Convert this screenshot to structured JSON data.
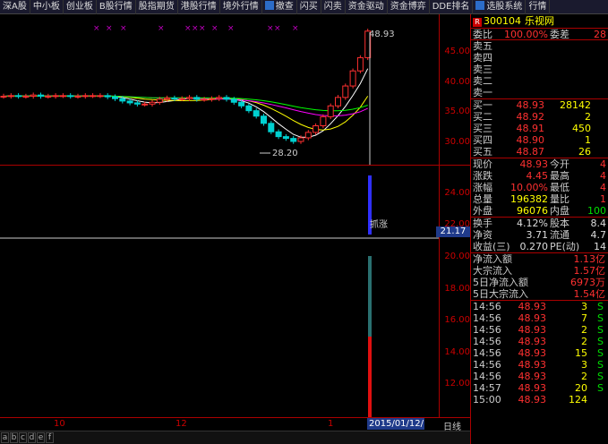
{
  "toolbar": [
    {
      "label": "深A股"
    },
    {
      "label": "中小板"
    },
    {
      "label": "创业板"
    },
    {
      "label": "B股行情"
    },
    {
      "label": "股指期货"
    },
    {
      "label": "港股行情"
    },
    {
      "label": "境外行情"
    },
    {
      "label": "撤查",
      "icon": "search-icon"
    },
    {
      "label": "闪买"
    },
    {
      "label": "闪卖"
    },
    {
      "label": "资金驱动"
    },
    {
      "label": "资金博弈"
    },
    {
      "label": "DDE排名"
    },
    {
      "label": "选股系统",
      "icon": "stock-select-icon"
    },
    {
      "label": "行情"
    }
  ],
  "main_chart": {
    "y_labels": [
      "45.00",
      "40.00",
      "35.00",
      "30.00"
    ],
    "high_label": "48.93",
    "low_label": "28.20"
  },
  "sub_chart": {
    "y_labels": [
      "24.00",
      "22.00",
      "20.00",
      "18.00",
      "16.00",
      "14.00",
      "12.00"
    ],
    "price_tag": "21.17",
    "signal_label": "抓涨"
  },
  "dates": {
    "labels": [
      {
        "text": "10"
      },
      {
        "text": "12"
      },
      {
        "text": "1"
      }
    ],
    "current": "2015/01/12/一",
    "period": "日线"
  },
  "bottom_tabs": [
    "a",
    "b",
    "c",
    "d",
    "e",
    "f"
  ],
  "stock": {
    "badge": "R",
    "code": "300104",
    "name": "乐视网"
  },
  "ratio_row": {
    "label1": "委比",
    "value1": "100.00%",
    "label2": "委差",
    "value2": "28"
  },
  "sell_levels": [
    "卖五",
    "卖四",
    "卖三",
    "卖二",
    "卖一"
  ],
  "buy_levels": [
    {
      "label": "买一",
      "price": "48.93",
      "vol": "28142"
    },
    {
      "label": "买二",
      "price": "48.92",
      "vol": "2"
    },
    {
      "label": "买三",
      "price": "48.91",
      "vol": "450"
    },
    {
      "label": "买四",
      "price": "48.90",
      "vol": "1"
    },
    {
      "label": "买五",
      "price": "48.87",
      "vol": "26"
    }
  ],
  "quote": [
    {
      "l1": "现价",
      "v1": "48.93",
      "l2": "今开",
      "v2": "4"
    },
    {
      "l1": "涨跌",
      "v1": "4.45",
      "l2": "最高",
      "v2": "4"
    },
    {
      "l1": "涨幅",
      "v1": "10.00%",
      "l2": "最低",
      "v2": "4"
    },
    {
      "l1": "总量",
      "v1": "196382",
      "l2": "量比",
      "v2": "1"
    },
    {
      "l1": "外盘",
      "v1": "96076",
      "l2": "内盘",
      "v2": "100"
    }
  ],
  "fundamentals": [
    {
      "l1": "换手",
      "v1": "4.12%",
      "l2": "股本",
      "v2": "8.4"
    },
    {
      "l1": "净资",
      "v1": "3.71",
      "l2": "流通",
      "v2": "4.7"
    },
    {
      "l1": "收益(三)",
      "v1": "0.270",
      "l2": "PE(动)",
      "v2": "14"
    }
  ],
  "flows": [
    {
      "label": "净流入额",
      "value": "1.13亿"
    },
    {
      "label": "大宗流入",
      "value": "1.57亿"
    },
    {
      "label": "5日净流入额",
      "value": "6973万"
    },
    {
      "label": "5日大宗流入",
      "value": "1.54亿"
    }
  ],
  "ticks": [
    {
      "time": "14:56",
      "price": "48.93",
      "vol": "3",
      "dir": "S"
    },
    {
      "time": "14:56",
      "price": "48.93",
      "vol": "7",
      "dir": "S"
    },
    {
      "time": "14:56",
      "price": "48.93",
      "vol": "2",
      "dir": "S"
    },
    {
      "time": "14:56",
      "price": "48.93",
      "vol": "2",
      "dir": "S"
    },
    {
      "time": "14:56",
      "price": "48.93",
      "vol": "15",
      "dir": "S"
    },
    {
      "time": "14:56",
      "price": "48.93",
      "vol": "3",
      "dir": "S"
    },
    {
      "time": "14:56",
      "price": "48.93",
      "vol": "2",
      "dir": "S"
    },
    {
      "time": "14:57",
      "price": "48.93",
      "vol": "20",
      "dir": "S"
    },
    {
      "time": "15:00",
      "price": "48.93",
      "vol": "124",
      "dir": ""
    }
  ],
  "colors": {
    "up": "#ff3030",
    "down": "#00e0e0",
    "axis": "#aa0000",
    "ma1": "#ffffff",
    "ma2": "#ffff00",
    "ma3": "#ff00ff",
    "ma4": "#00ff00"
  }
}
